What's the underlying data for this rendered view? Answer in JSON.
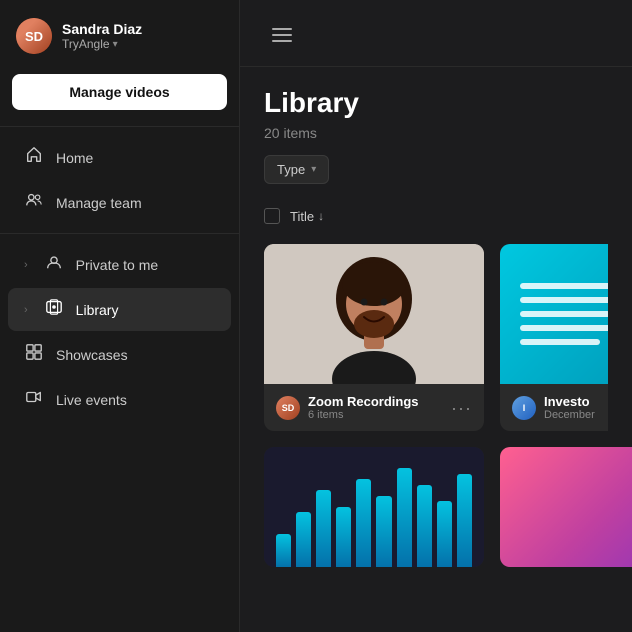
{
  "sidebar": {
    "user": {
      "name": "Sandra Diaz",
      "workspace": "TryAngle",
      "avatar_initials": "SD"
    },
    "manage_videos_label": "Manage videos",
    "nav_items": [
      {
        "id": "home",
        "label": "Home",
        "icon": "🏠",
        "active": false,
        "expandable": false
      },
      {
        "id": "manage-team",
        "label": "Manage team",
        "icon": "👥",
        "active": false,
        "expandable": false
      },
      {
        "id": "private-to-me",
        "label": "Private to me",
        "icon": "👤",
        "active": false,
        "expandable": true
      },
      {
        "id": "library",
        "label": "Library",
        "icon": "📺",
        "active": true,
        "expandable": true
      },
      {
        "id": "showcases",
        "label": "Showcases",
        "icon": "📋",
        "active": false,
        "expandable": false
      },
      {
        "id": "live-events",
        "label": "Live events",
        "icon": "🎥",
        "active": false,
        "expandable": false
      }
    ]
  },
  "main": {
    "hamburger_label": "menu",
    "page_title": "Library",
    "item_count": "20 items",
    "type_filter_label": "Type",
    "title_column_label": "Title",
    "cards": [
      {
        "id": "zoom-recordings",
        "name": "Zoom Recordings",
        "sub": "6 items",
        "type": "person",
        "avatar": "SD"
      },
      {
        "id": "investor",
        "name": "Investo",
        "sub": "December",
        "type": "cyan",
        "avatar": "I"
      }
    ],
    "row2_cards": [
      {
        "id": "chart-card",
        "type": "chart",
        "bars": [
          30,
          50,
          70,
          55,
          80,
          65,
          90,
          75,
          60,
          85
        ]
      },
      {
        "id": "gradient-card",
        "type": "gradient"
      }
    ]
  }
}
